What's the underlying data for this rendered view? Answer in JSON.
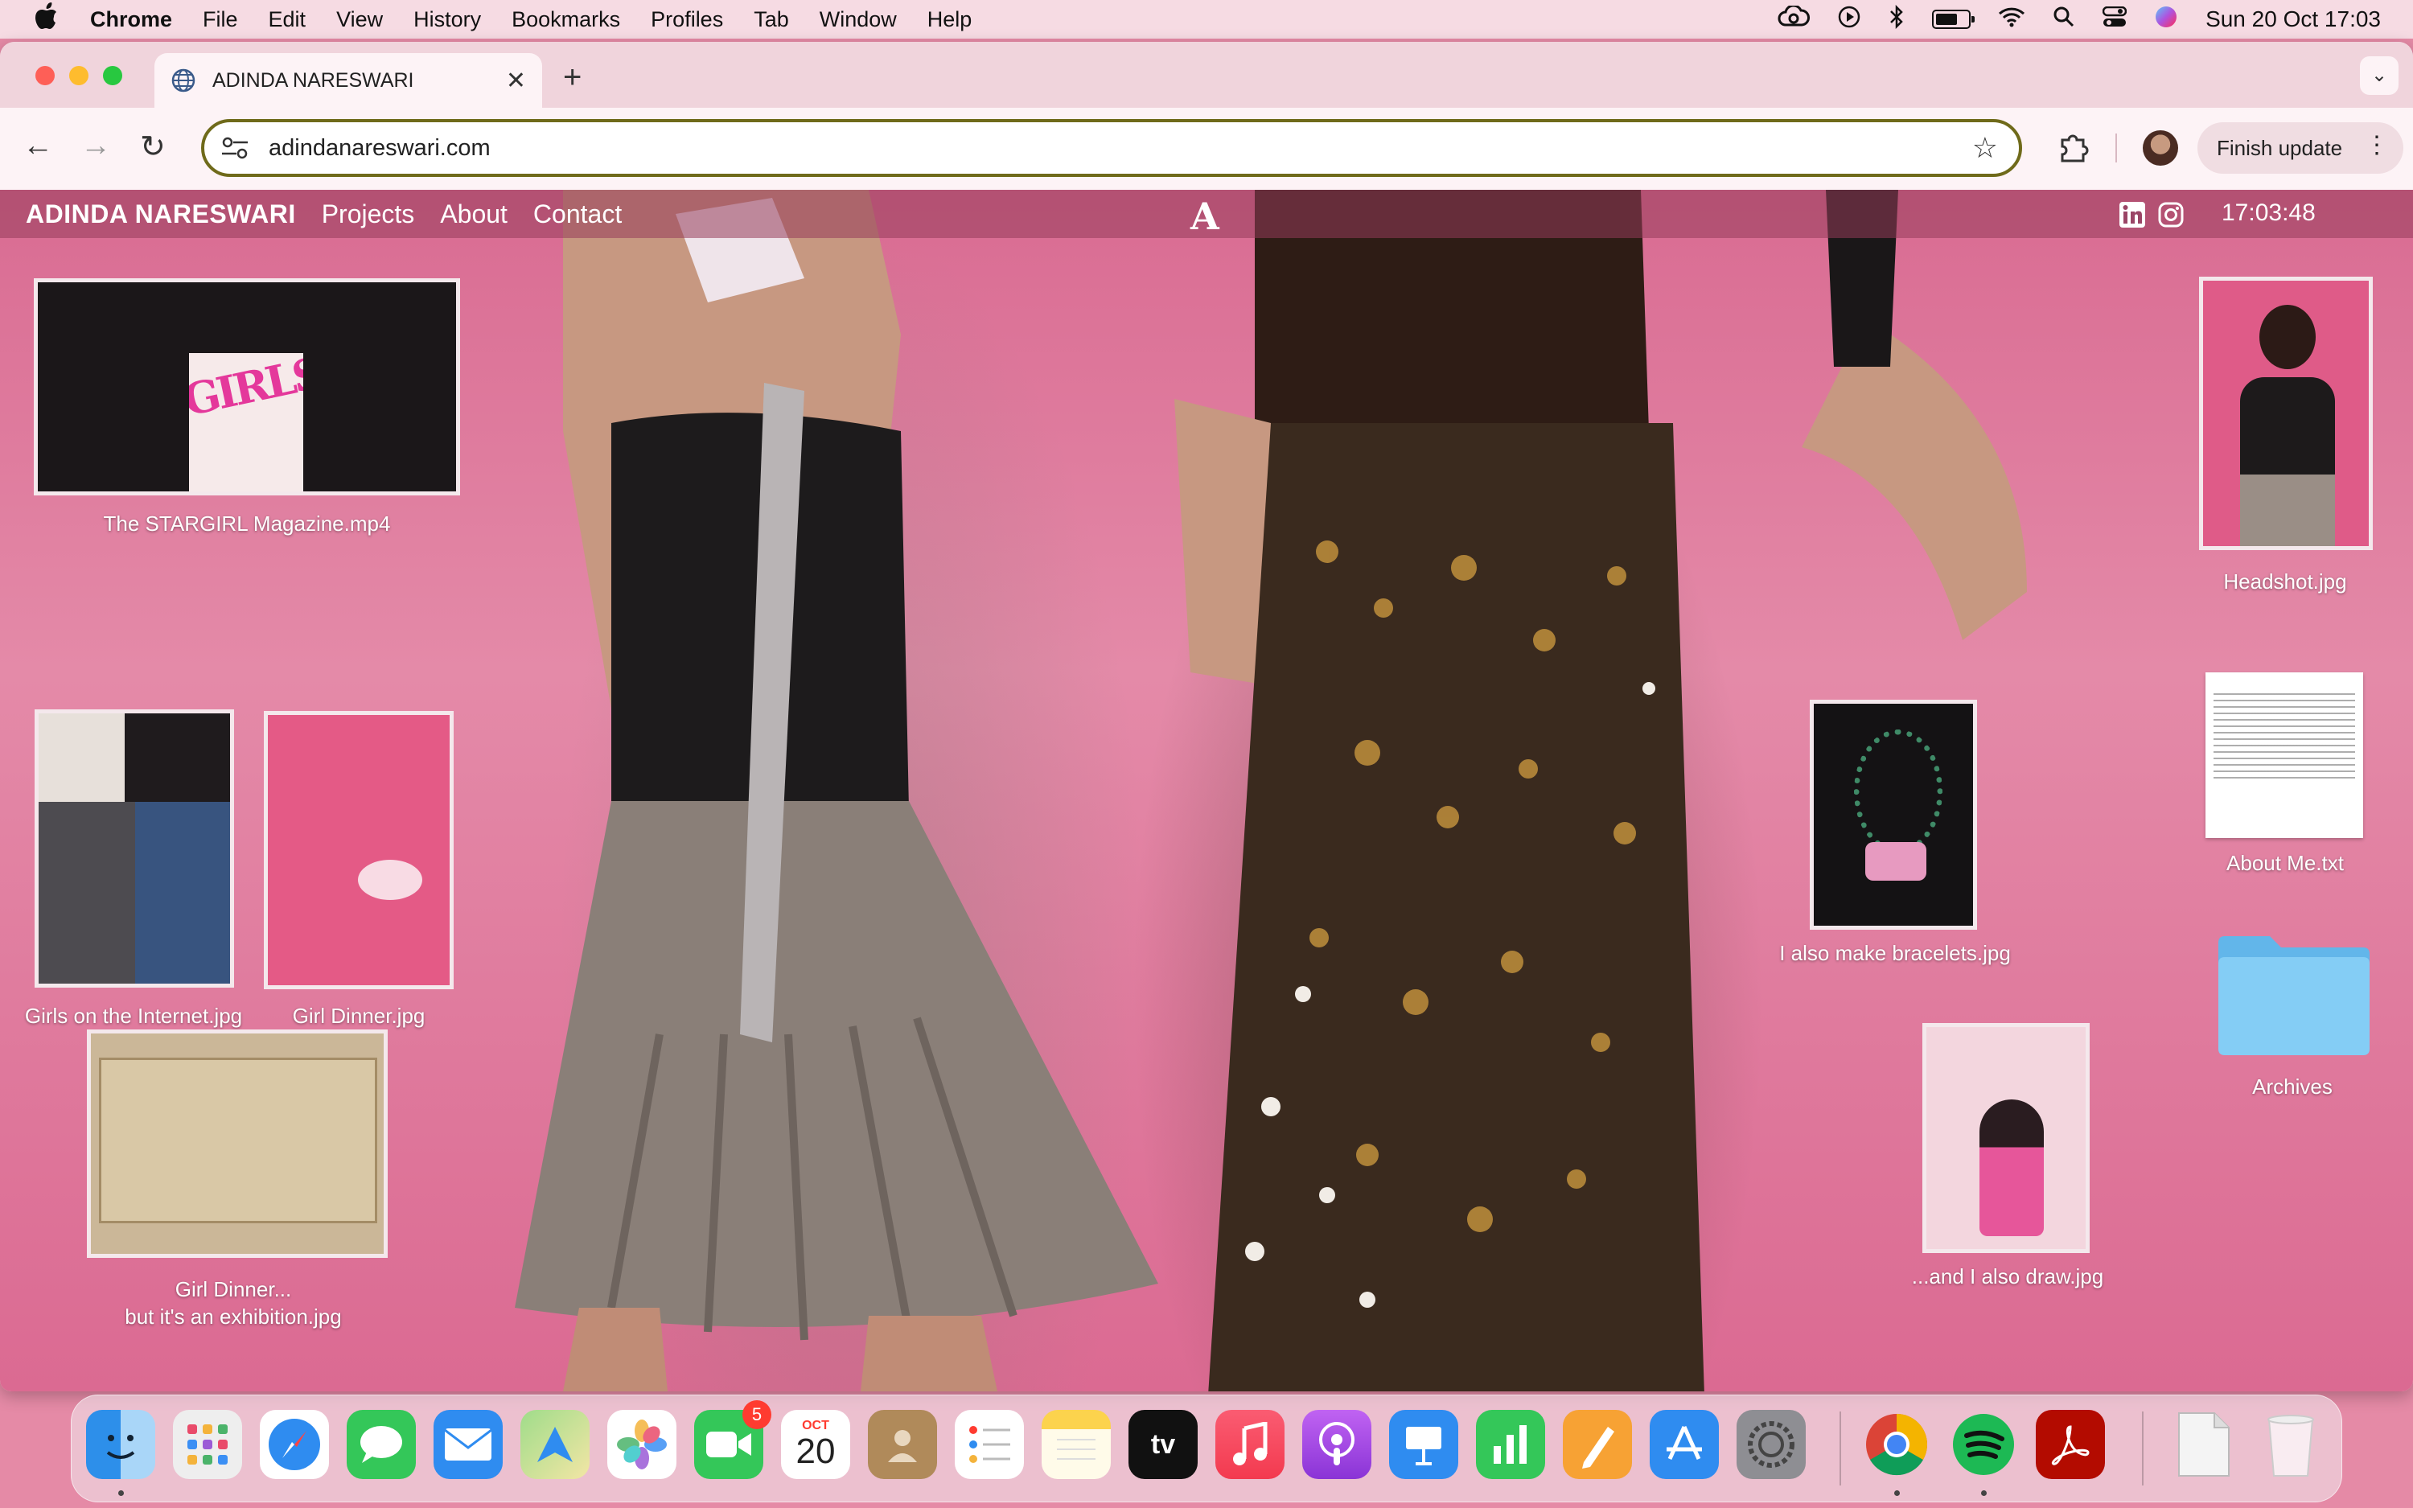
{
  "menubar": {
    "app_name": "Chrome",
    "items": [
      "File",
      "Edit",
      "View",
      "History",
      "Bookmarks",
      "Profiles",
      "Tab",
      "Window",
      "Help"
    ],
    "datetime": "Sun 20 Oct  17:03"
  },
  "browser": {
    "tab_title": "ADINDA NARESWARI",
    "url": "adindanareswari.com",
    "finish_update_label": "Finish update"
  },
  "site": {
    "brand": "ADINDA NARESWARI",
    "nav": [
      "Projects",
      "About",
      "Contact"
    ],
    "logo": "A",
    "clock": "17:03:48",
    "thumb_text": "GIRLS"
  },
  "desktop_items": {
    "stargirl": "The STARGIRL Magazine.mp4",
    "girls_internet": "Girls on the Internet.jpg",
    "girl_dinner": "Girl Dinner.jpg",
    "exhibition_line1": "Girl Dinner...",
    "exhibition_line2": "but it's an exhibition.jpg",
    "bracelets": "I also make bracelets.jpg",
    "draw": "...and I also draw.jpg",
    "headshot": "Headshot.jpg",
    "about_me": "About Me.txt",
    "archives": "Archives"
  },
  "dock": {
    "calendar_month": "OCT",
    "calendar_day": "20",
    "facetime_badge": "5",
    "tv_label": "tv"
  },
  "colors": {
    "accent_omnibox": "#6f6a1a",
    "page_pink": "#e58aa6"
  }
}
